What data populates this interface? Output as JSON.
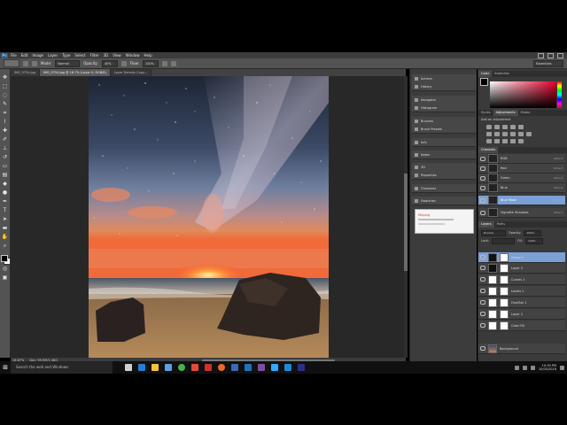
{
  "menubar": {
    "logo": "Ps",
    "items": [
      "File",
      "Edit",
      "Image",
      "Layer",
      "Type",
      "Select",
      "Filter",
      "3D",
      "View",
      "Window",
      "Help"
    ]
  },
  "options": {
    "mode_label": "Mode:",
    "mode_value": "Normal",
    "opacity_label": "Opacity:",
    "opacity_value": "40%",
    "flow_label": "Flow:",
    "flow_value": "100%",
    "workspace": "Essentials"
  },
  "doc_tabs": [
    "IMG_9754.jpg",
    "IMG_9754.jpg @ 16.7% (Layer 0, RGB/8)",
    "Layer Density Copy..."
  ],
  "statusbar": {
    "zoom": "16.67%",
    "doc": "Doc: 99.9M/1.46G"
  },
  "dock": {
    "group1": [
      "Actions",
      "History"
    ],
    "group2": [
      "Navigator",
      "Histogram"
    ],
    "group3": [
      "Brushes",
      "Brush Presets"
    ],
    "group4": [
      "Info"
    ],
    "group5": [
      "Notes",
      "Paths"
    ],
    "group6": [
      "3D",
      "Properties",
      "Timeline"
    ],
    "group7": [
      "Character",
      "Paragraph"
    ],
    "group8": [
      "Swatches"
    ],
    "notepad_text": "Missing"
  },
  "right_panel": {
    "color_tabs": [
      "Color",
      "Swatches"
    ],
    "adj_tabs": [
      "Styles",
      "Adjustments",
      "Masks"
    ],
    "adj_heading": "Add an adjustment",
    "channels_tabs": [
      "Channels"
    ],
    "channels": [
      {
        "name": "RGB",
        "shortcut": "Ctrl+2"
      },
      {
        "name": "Red",
        "shortcut": "Ctrl+3"
      },
      {
        "name": "Green",
        "shortcut": "Ctrl+4"
      },
      {
        "name": "Blue",
        "shortcut": "Ctrl+5"
      },
      {
        "name": "Blue Mask",
        "shortcut": "Ctrl+6"
      },
      {
        "name": "Vignette Shadows",
        "shortcut": "Ctrl+7"
      }
    ],
    "layers_tabs": [
      "Layers",
      "Paths"
    ],
    "blend_mode": "Normal",
    "opacity_label": "Opacity:",
    "opacity_value": "100%",
    "lock_label": "Lock:",
    "fill_label": "Fill:",
    "fill_value": "100%",
    "layers": [
      {
        "name": "Group 1"
      },
      {
        "name": "Layer 2"
      },
      {
        "name": "Curves 1"
      },
      {
        "name": "Levels 1"
      },
      {
        "name": "Hue/Sat 1"
      },
      {
        "name": "Layer 1"
      },
      {
        "name": "Color Fill"
      },
      {
        "name": "Background"
      }
    ]
  },
  "taskbar": {
    "search_placeholder": "Search the web and Windows",
    "time": "10:39 PM",
    "date": "10/05/2016"
  }
}
